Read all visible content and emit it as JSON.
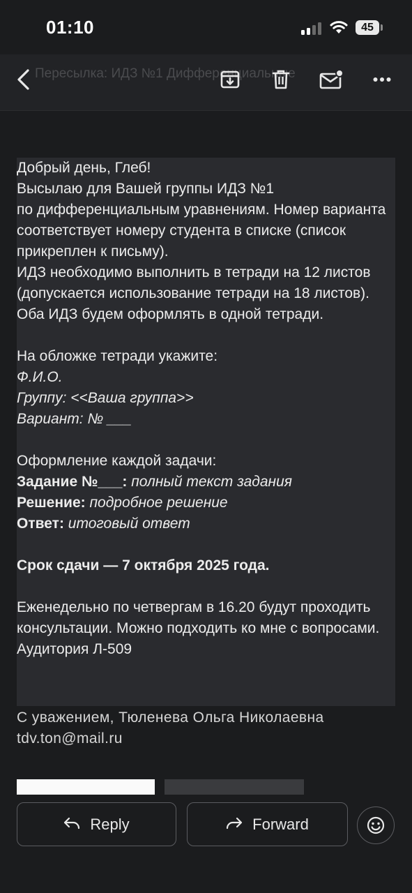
{
  "status": {
    "time": "01:10",
    "battery": "45"
  },
  "toolbar": {
    "faded_title": "Пересылка: ИДЗ №1 Дифференциальные"
  },
  "message": {
    "greeting": "Добрый день, Глеб!",
    "line1": "Высылаю для Вашей группы ИДЗ №1",
    "line2": "по дифференциальным уравнениям. Номер варианта соответствует номеру студента в списке (список прикреплен к письму).",
    "line3": "ИДЗ необходимо выполнить в тетради на 12 листов (допускается использование тетради на 18 листов). Оба ИДЗ будем оформлять в одной тетради.",
    "cover_heading": "На обложке тетради укажите:",
    "cover_name": "Ф.И.О.",
    "cover_group": "Группу: <<Ваша группа>>",
    "cover_variant": "Вариант: № ___",
    "format_heading": "Оформление каждой задачи:",
    "task_label": "Задание №___:",
    "task_value": "полный текст задания",
    "solution_label": "Решение:",
    "solution_value": "подробное решение",
    "answer_label": "Ответ:",
    "answer_value": "итоговый ответ",
    "deadline": "Срок сдачи — 7 октября 2025 года.",
    "consult": "Еженедельно по четвергам в 16.20 будут проходить консультации. Можно подходить ко мне с вопросами. Аудитория Л-509"
  },
  "signature": {
    "line1": "С уважением, Тюленева Ольга Николаевна",
    "email": "tdv.ton@mail.ru"
  },
  "actions": {
    "reply": "Reply",
    "forward": "Forward"
  },
  "icons": {
    "back": "back-arrow-icon",
    "archive": "archive-icon",
    "delete": "trash-icon",
    "unread": "mark-unread-icon",
    "more": "more-options-icon",
    "reply": "reply-arrow-icon",
    "forward": "forward-arrow-icon",
    "emoji": "emoji-reaction-icon"
  }
}
